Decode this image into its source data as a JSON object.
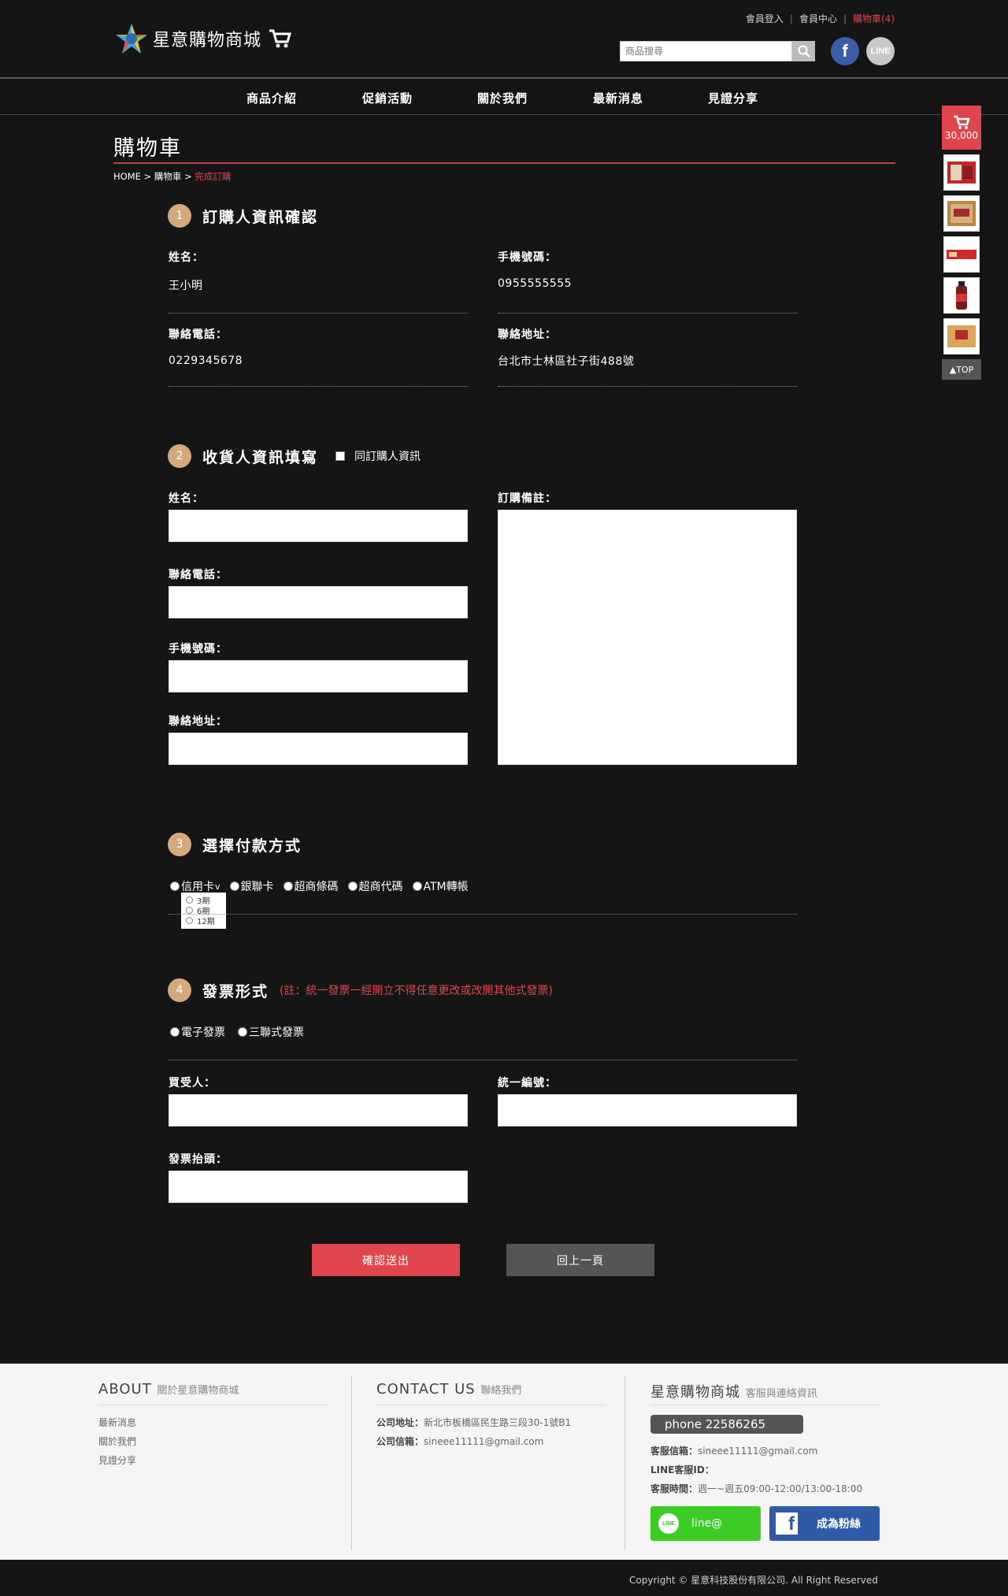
{
  "header": {
    "logo_text": "星意購物商城",
    "links": {
      "login": "會員登入",
      "member": "會員中心",
      "cart": "購物車(4)",
      "sep": "|"
    },
    "search_placeholder": "商品搜尋",
    "facebook_letter": "f",
    "line_text": "LINE"
  },
  "nav": {
    "items": [
      "商品介紹",
      "促銷活動",
      "關於我們",
      "最新消息",
      "見證分享"
    ]
  },
  "page": {
    "title": "購物車",
    "breadcrumb": {
      "home": "HOME",
      "arrow": ">",
      "cart": "購物車",
      "current": "完成訂購"
    }
  },
  "section1": {
    "num": "1",
    "title": "訂購人資訊確認",
    "name_label": "姓名：",
    "name_value": "王小明",
    "mobile_label": "手機號碼：",
    "mobile_value": "0955555555",
    "phone_label": "聯絡電話：",
    "phone_value": "0229345678",
    "address_label": "聯絡地址：",
    "address_value": "台北市士林區社子街488號"
  },
  "section2": {
    "num": "2",
    "title": "收貨人資訊填寫",
    "same_as_buyer": "同訂購人資訊",
    "name_label": "姓名：",
    "phone_label": "聯絡電話：",
    "mobile_label": "手機號碼：",
    "address_label": "聯絡地址：",
    "note_label": "訂購備註："
  },
  "section3": {
    "num": "3",
    "title": "選擇付款方式",
    "options": [
      "信用卡",
      "銀聯卡",
      "超商條碼",
      "超商代碼",
      "ATM轉帳"
    ],
    "chevron": "v",
    "installments": [
      "3期",
      "6期",
      "12期"
    ]
  },
  "section4": {
    "num": "4",
    "title": "發票形式",
    "note": "(註：統一發票一經開立不得任意更改或改開其他式發票)",
    "options": [
      "電子發票",
      "三聯式發票"
    ],
    "buyer_label": "買受人：",
    "tax_id_label": "統一編號：",
    "invoice_title_label": "發票抬頭："
  },
  "buttons": {
    "submit": "確認送出",
    "back": "回上一頁"
  },
  "sidebar": {
    "cart_total": "30,000",
    "top": "▲TOP"
  },
  "footer": {
    "about_title": "ABOUT",
    "about_sub": "關於星意購物商城",
    "about_links": [
      "最新消息",
      "關於我們",
      "見證分享"
    ],
    "contact_title": "CONTACT US",
    "contact_sub": "聯絡我們",
    "address_label": "公司地址：",
    "address_value": "新北市板橋區民生路三段30-1號B1",
    "email_label": "公司信箱：",
    "email_value": "sineee11111@gmail.com",
    "service_title": "星意購物商城",
    "service_sub": "客服與連絡資訊",
    "phone": "phone 22586265",
    "service_email_label": "客服信箱：",
    "service_email_value": "sineee11111@gmail.com",
    "line_id_label": "LINE客服ID：",
    "hours_label": "客服時間：",
    "hours_value": "週一~週五09:00-12:00/13:00-18:00",
    "line_button": "line@",
    "line_icon_text": "LINE",
    "fb_button": "成為粉絲",
    "fb_icon_letter": "f"
  },
  "copyright": "Copyright © 星意科技股份有限公司. All Right Reserved",
  "colors": {
    "accent_red": "#e0454d",
    "step_gold": "#d4aa7d",
    "line_green": "#3dcc25",
    "fb_blue": "#2f5aa7"
  }
}
